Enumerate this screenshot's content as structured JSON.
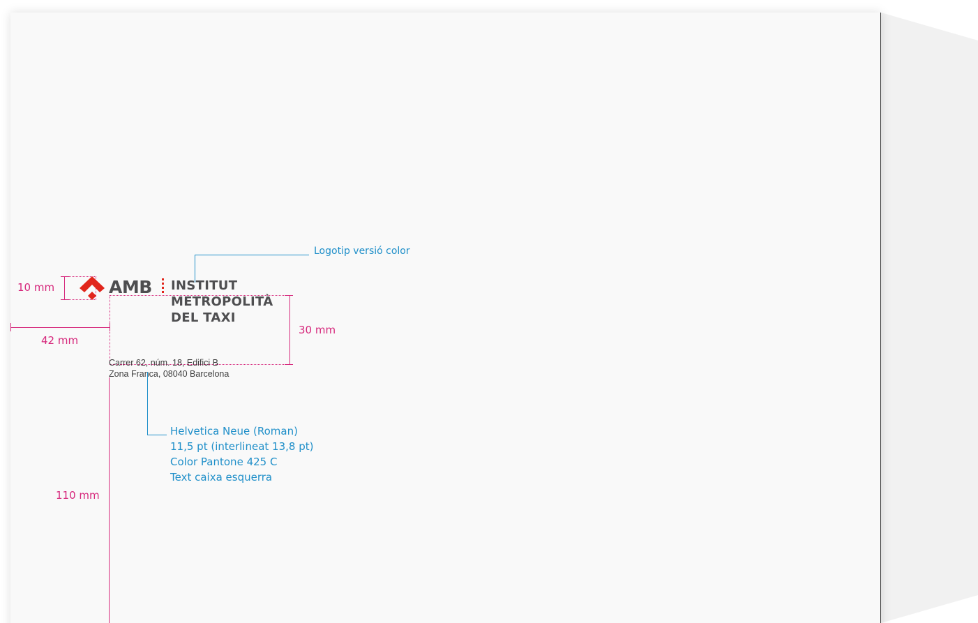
{
  "dimensions": {
    "logo_height": "10 mm",
    "left_margin": "42 mm",
    "block_height": "30 mm",
    "top_offset": "110 mm"
  },
  "logo": {
    "acronym": "AMB",
    "lines": [
      "INSTITUT",
      "METROPOLITÀ",
      "DEL TAXI"
    ],
    "symbol_color": "#e1251b",
    "text_color": "#4e4e50"
  },
  "address": {
    "line1": "Carrer 62, núm. 18, Edifici B",
    "line2": "Zona Franca, 08040 Barcelona"
  },
  "annotations": {
    "logo_note": "Logotip versió color",
    "type_spec": [
      "Helvetica Neue (Roman)",
      "11,5 pt (interlineat 13,8 pt)",
      "Color Pantone 425 C",
      "Text caixa esquerra"
    ]
  },
  "colors": {
    "dimension": "#d6287c",
    "annotation": "#1f8fc9",
    "paper": "#f9f9f9"
  }
}
